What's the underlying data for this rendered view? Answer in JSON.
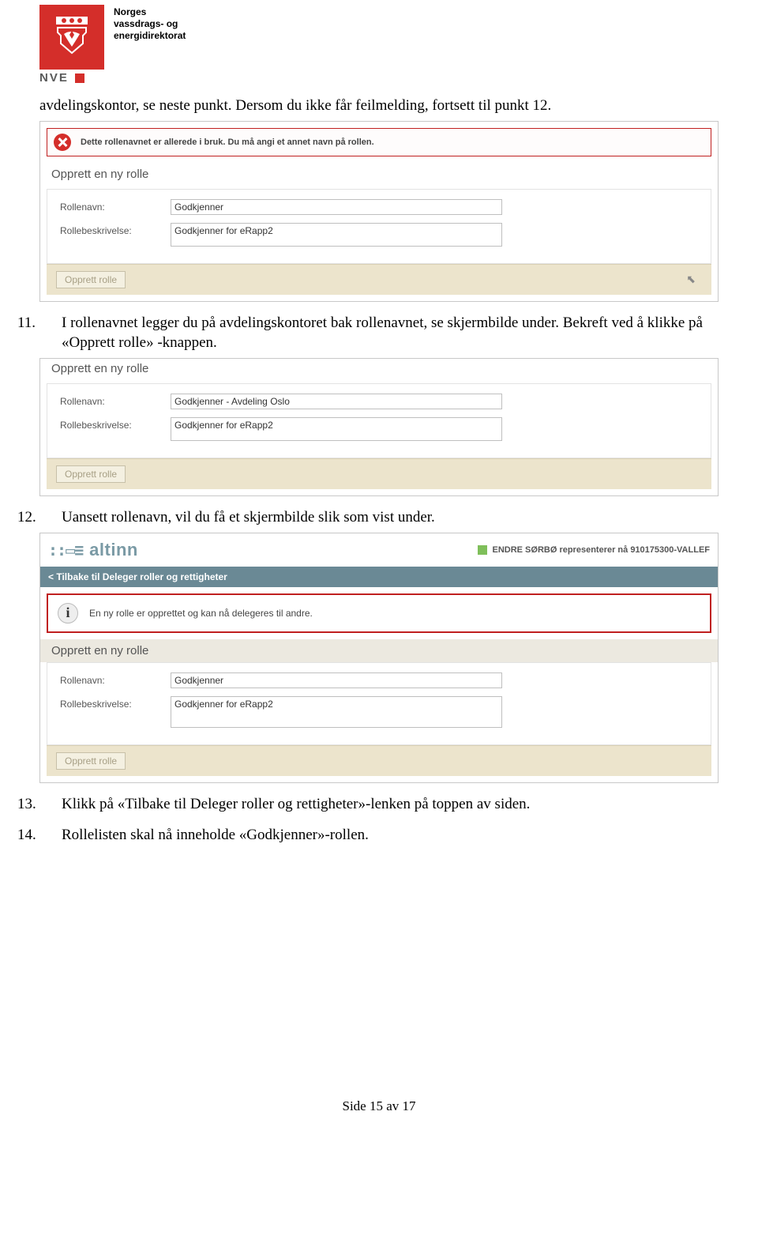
{
  "header": {
    "org_line1": "Norges",
    "org_line2": "vassdrags- og",
    "org_line3": "energidirektorat",
    "abbr": "NVE"
  },
  "para_top": "avdelingskontor, se neste punkt. Dersom du ikke får feilmelding, fortsett til punkt 12.",
  "shot1": {
    "error_text": "Dette rollenavnet er allerede i bruk. Du må angi et annet navn på rollen.",
    "section": "Opprett en ny rolle",
    "label_name": "Rollenavn:",
    "label_desc": "Rollebeskrivelse:",
    "value_name": "Godkjenner",
    "value_desc": "Godkjenner for eRapp2",
    "button": "Opprett rolle"
  },
  "step11": {
    "num": "11.",
    "text": "I rollenavnet legger du på avdelingskontoret bak rollenavnet, se skjermbilde under. Bekreft ved å klikke på «Opprett rolle» -knappen."
  },
  "shot2": {
    "section": "Opprett en ny rolle",
    "label_name": "Rollenavn:",
    "label_desc": "Rollebeskrivelse:",
    "value_name": "Godkjenner - Avdeling Oslo",
    "value_desc": "Godkjenner for eRapp2",
    "button": "Opprett rolle"
  },
  "step12": {
    "num": "12.",
    "text": "Uansett rollenavn, vil du få et skjermbilde slik som vist under."
  },
  "shot3": {
    "brand": "altinn",
    "rep_text": "ENDRE SØRBØ representerer nå 910175300-VALLEF",
    "back_link": "<  Tilbake til Deleger roller og rettigheter",
    "info_text": "En ny rolle er opprettet og kan nå delegeres til andre.",
    "section": "Opprett en ny rolle",
    "label_name": "Rollenavn:",
    "label_desc": "Rollebeskrivelse:",
    "value_name": "Godkjenner",
    "value_desc": "Godkjenner for eRapp2",
    "button": "Opprett rolle"
  },
  "step13": {
    "num": "13.",
    "text": "Klikk på «Tilbake til Deleger roller og rettigheter»-lenken på toppen av siden."
  },
  "step14": {
    "num": "14.",
    "text": "Rollelisten skal nå inneholde «Godkjenner»-rollen."
  },
  "footer": "Side 15 av 17"
}
